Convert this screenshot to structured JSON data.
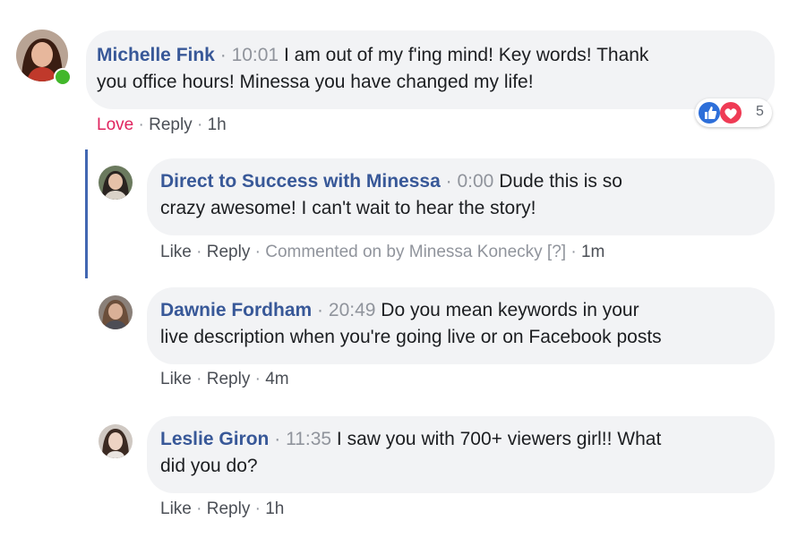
{
  "comments": [
    {
      "author": "Michelle Fink",
      "timestamp": "10:01",
      "text_line1": "I am out of my f'ing mind! Key words! Thank",
      "text_line2": "you office hours! Minessa you have changed my life!",
      "reaction_label": "Love",
      "reply_label": "Reply",
      "age": "1h",
      "reaction_icons": [
        "like-icon",
        "love-icon"
      ],
      "reaction_count": "5"
    },
    {
      "author": "Direct to Success with Minessa",
      "timestamp": "0:00",
      "text_line1": "Dude this is so",
      "text_line2": "crazy awesome! I can't wait to hear the story!",
      "like_label": "Like",
      "reply_label": "Reply",
      "meta": "Commented on by Minessa Konecky [?]",
      "age": "1m"
    },
    {
      "author": "Dawnie Fordham",
      "timestamp": "20:49",
      "text_line1": "Do you mean keywords in your",
      "text_line2": "live description when you're going live or on Facebook posts",
      "like_label": "Like",
      "reply_label": "Reply",
      "age": "4m"
    },
    {
      "author": "Leslie Giron",
      "timestamp": "11:35",
      "text_line1": "I saw you with 700+ viewers girl!! What",
      "text_line2": "did you do?",
      "like_label": "Like",
      "reply_label": "Reply",
      "age": "1h"
    }
  ],
  "colors": {
    "name": "#385898",
    "bubble": "#f2f3f5",
    "thread_line": "#4267b2",
    "love": "#e0245e",
    "online": "#42b72a"
  }
}
